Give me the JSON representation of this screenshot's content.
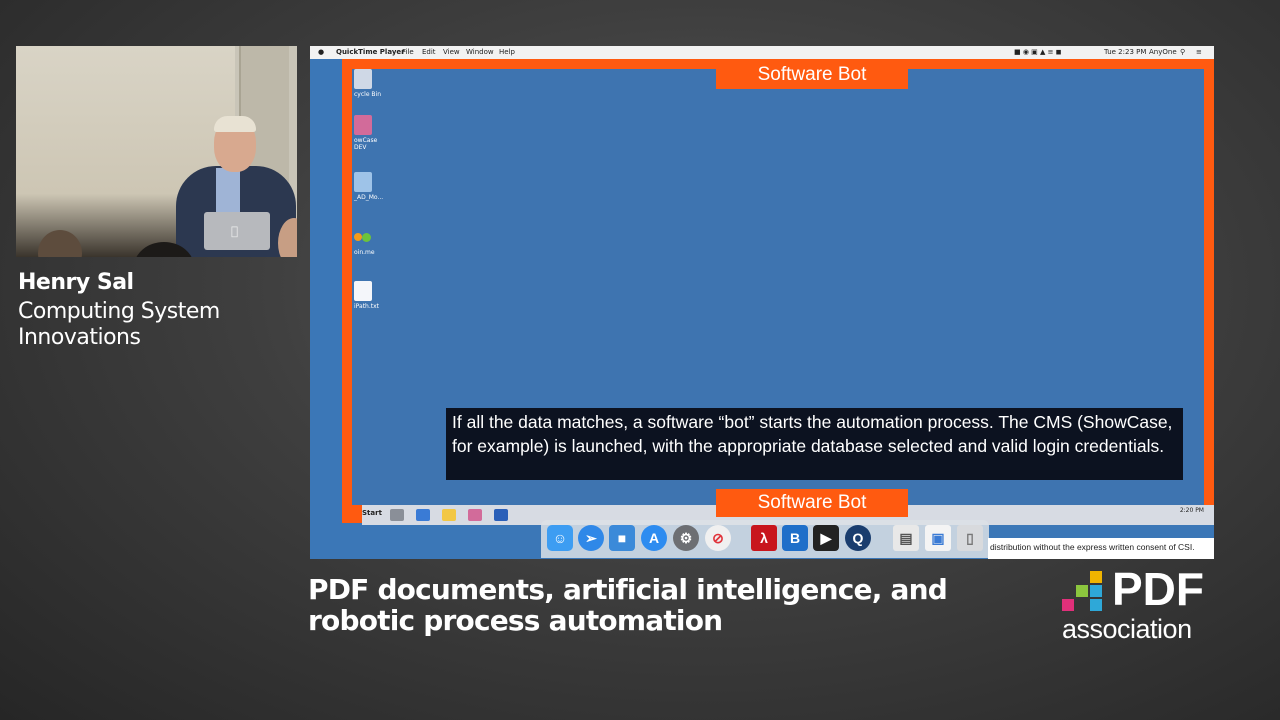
{
  "speaker": {
    "name": "Henry Sal",
    "organization": "Computing System Innovations"
  },
  "talk_title": "PDF documents, artificial intelligence, and robotic process automation",
  "brand": {
    "logo_word": "PDF",
    "logo_subword": "association",
    "square_colors": [
      "#e0307a",
      "#f0b400",
      "#2ea8d8",
      "#8cc63e"
    ]
  },
  "mac_menubar": {
    "app": "QuickTime Player",
    "menus": [
      "File",
      "Edit",
      "View",
      "Window",
      "Help"
    ],
    "clock": "Tue 2:23 PM",
    "user": "AnyOne"
  },
  "slide": {
    "top_label": "Software Bot",
    "bottom_label": "Software Bot",
    "caption": "If all the data matches, a software “bot” starts the automation process.  The CMS (ShowCase, for example) is launched, with the appropriate database selected and valid login credentials.",
    "frame_color": "#ff5a10",
    "desktop_color": "#3e74b0"
  },
  "desktop_icons": [
    {
      "label": "cycle Bin",
      "icon": "recycle-bin-icon"
    },
    {
      "label": "owCase DEV",
      "icon": "showcase-icon"
    },
    {
      "label": "_AD_Mo...",
      "icon": "image-file-icon"
    },
    {
      "label": "oin.me",
      "icon": "joinme-icon"
    },
    {
      "label": "iPath.txt",
      "icon": "text-file-icon"
    }
  ],
  "windows_taskbar": {
    "start_label": "Start",
    "time": "2:20 PM"
  },
  "dock_icons": [
    "finder-icon",
    "safari-icon",
    "keynote-icon",
    "app-store-icon",
    "system-preferences-icon",
    "news-icon",
    "acrobat-icon",
    "bbedit-icon",
    "final-cut-icon",
    "quicktime-icon",
    "documents-icon",
    "preview-icon",
    "trash-icon"
  ],
  "copyright_text": "distribution without the express written consent of CSI."
}
